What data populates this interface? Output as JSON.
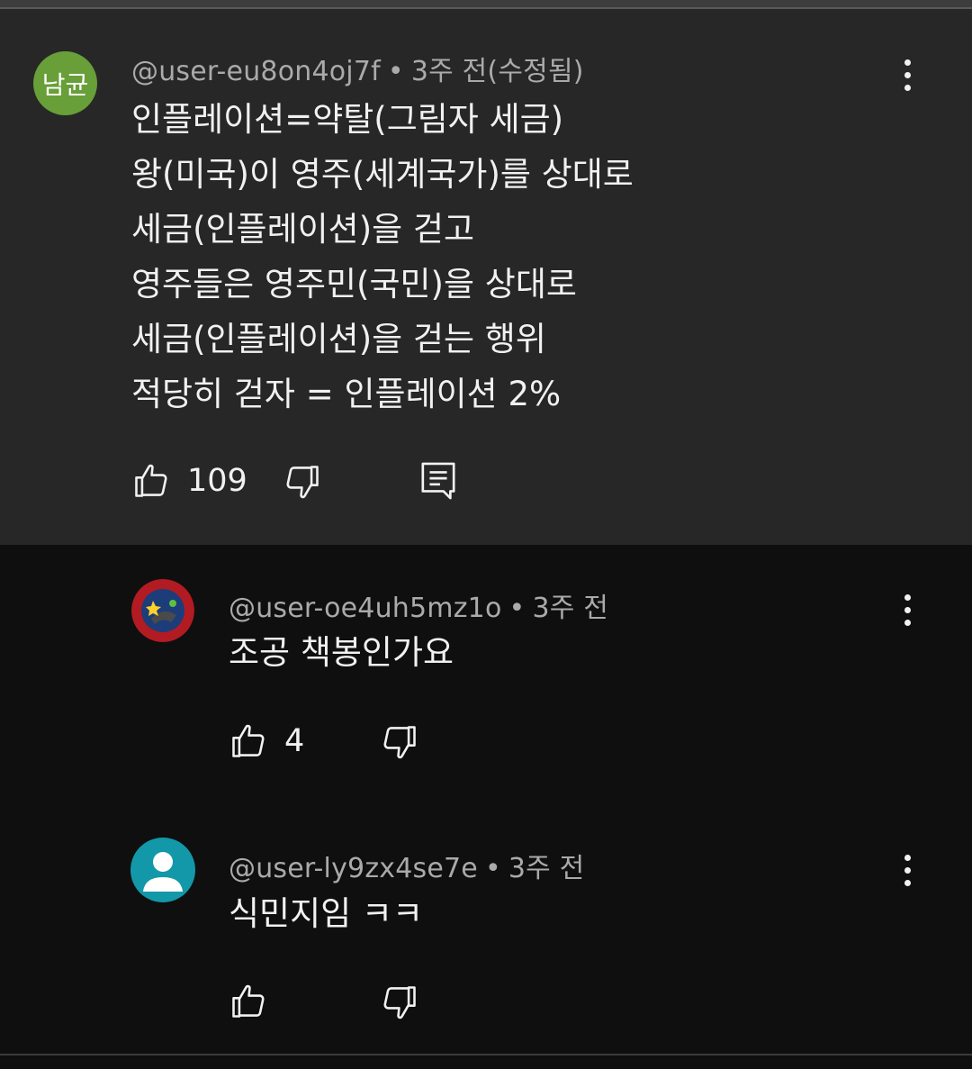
{
  "comments": [
    {
      "avatar_text": "남균",
      "avatar_color": "#689f38",
      "author": "@user-eu8on4oj7f",
      "separator": "•",
      "time": "3주 전(수정됨)",
      "lines": [
        "인플레이션=약탈(그림자 세금)",
        "왕(미국)이 영주(세계국가)를 상대로",
        "세금(인플레이션)을 걷고",
        "영주들은 영주민(국민)을 상대로",
        "세금(인플레이션)을 걷는 행위",
        "적당히 걷자 = 인플레이션 2%"
      ],
      "likes": "109",
      "icons": {
        "like": "thumbs-up-icon",
        "dislike": "thumbs-down-icon",
        "reply": "reply-comment-icon",
        "menu": "more-vert-icon"
      }
    }
  ],
  "replies": [
    {
      "author": "@user-oe4uh5mz1o",
      "separator": "•",
      "time": "3주 전",
      "text": "조공 책봉인가요",
      "likes": "4",
      "avatar_icon": "round-badge-avatar",
      "badge_top_text": "FLOAT AROUND AND FIND OUT",
      "badge_bottom_text": "PCE IT 2023"
    },
    {
      "author": "@user-ly9zx4se7e",
      "separator": "•",
      "time": "3주 전",
      "text": "식민지임 ㅋㅋ",
      "likes": "",
      "avatar_icon": "default-person-avatar",
      "avatar_color": "#1298a8"
    }
  ],
  "colors": {
    "background": "#0f0f0f",
    "highlight": "#272727",
    "meta_text": "#aaaaaa",
    "text": "#f1f1f1"
  }
}
